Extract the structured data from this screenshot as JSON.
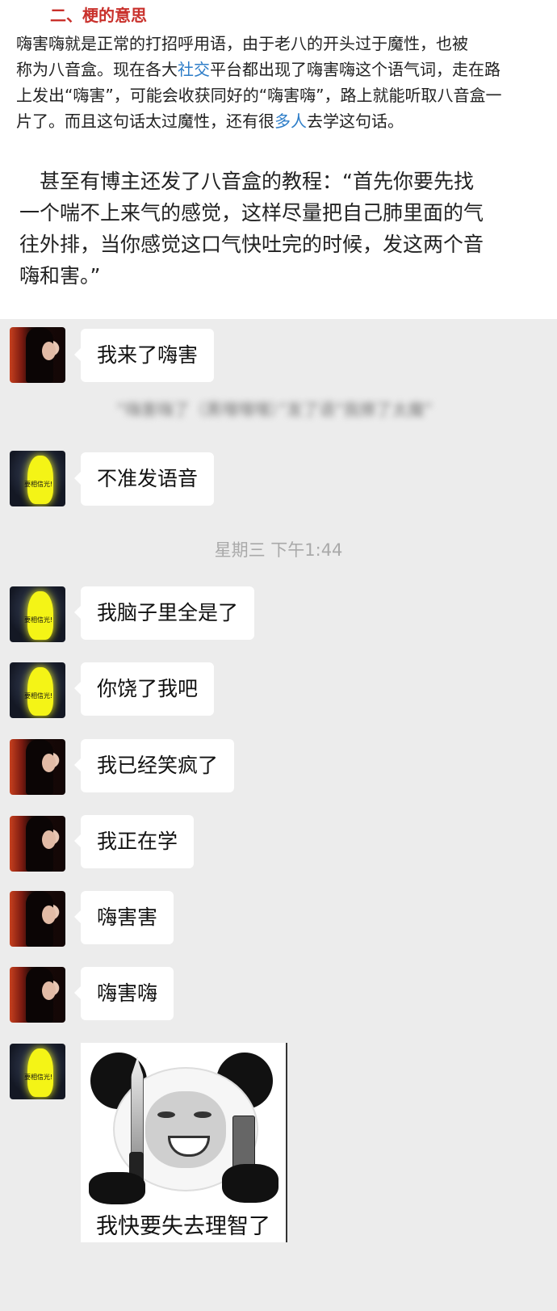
{
  "article": {
    "heading": "二、梗的意思",
    "para1": {
      "line1": "嗨害嗨就是正常的打招呼用语，由于老八的开头过于魔性，也被",
      "line2_before": "称为八音盒。现在各大",
      "line2_link": "社交",
      "line2_after": "平台都出现了嗨害嗨这个语气词，走在路",
      "line3": "上发出“嗨害”，可能会收获同好的“嗨害嗨”，路上就能听取八音盒一",
      "line4_before": "片了。而且这句话太过魔性，还有很",
      "line4_link": "多人",
      "line4_after": "去学这句话。"
    },
    "para2": {
      "line1": "　甚至有博主还发了八音盒的教程：“首先你要先找",
      "line2": "一个喘不上来气的感觉，这样尽量把自己肺里面的气",
      "line3": "往外排，当你感觉这口气快吐完的时候，发这两个音",
      "line4": "嗨和害。”"
    }
  },
  "chat": {
    "avatar_caption": "要相信光!",
    "blurred_text": "“嗨害嗨了（黑嘿嘿嘿）”发了语“我擦了太魔”",
    "timestamp": "星期三 下午1:44",
    "messages": [
      {
        "sender": "woman",
        "text": "我来了嗨害"
      },
      {
        "sender": "ultraman",
        "text": "不准发语音"
      },
      {
        "sender": "ultraman",
        "text": "我脑子里全是了"
      },
      {
        "sender": "ultraman",
        "text": "你饶了我吧"
      },
      {
        "sender": "woman",
        "text": "我已经笑疯了"
      },
      {
        "sender": "woman",
        "text": "我正在学"
      },
      {
        "sender": "woman",
        "text": "嗨害害"
      },
      {
        "sender": "woman",
        "text": "嗨害嗨"
      }
    ],
    "sticker_caption": "我快要失去理智了"
  }
}
